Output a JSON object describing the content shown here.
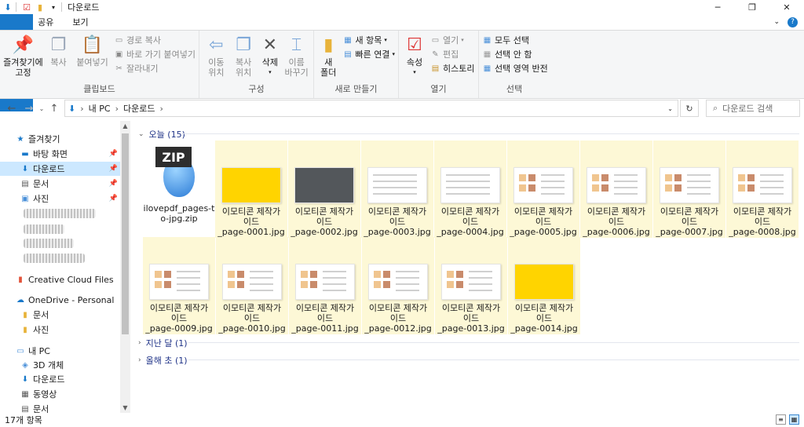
{
  "window": {
    "title": "다운로드",
    "minimize": "─",
    "maximize": "❐",
    "close": "✕"
  },
  "tabs": [
    "파일",
    "홈",
    "공유",
    "보기"
  ],
  "ribbon": {
    "clipboard": {
      "pin_label_1": "즐겨찾기에",
      "pin_label_2": "고정",
      "copy": "복사",
      "paste": "붙여넣기",
      "copy_path": "경로 복사",
      "paste_shortcut": "바로 가기 붙여넣기",
      "cut": "잘라내기",
      "group": "클립보드"
    },
    "organize": {
      "move_1": "이동",
      "move_2": "위치",
      "copy_1": "복사",
      "copy_2": "위치",
      "delete": "삭제",
      "rename_1": "이름",
      "rename_2": "바꾸기",
      "group": "구성"
    },
    "new": {
      "new_folder_1": "새",
      "new_folder_2": "폴더",
      "new_item": "새 항목",
      "easy_access": "빠른 연결",
      "group": "새로 만들기"
    },
    "open": {
      "properties": "속성",
      "open": "열기",
      "edit": "편집",
      "history": "히스토리",
      "group": "열기"
    },
    "select": {
      "select_all": "모두 선택",
      "select_none": "선택 안 함",
      "invert": "선택 영역 반전",
      "group": "선택"
    }
  },
  "address": {
    "crumbs": [
      "내 PC",
      "다운로드"
    ],
    "search_placeholder": "다운로드 검색"
  },
  "sidebar": {
    "quick_access": "즐겨찾기",
    "desktop": "바탕 화면",
    "downloads": "다운로드",
    "documents": "문서",
    "pictures": "사진",
    "creative_cloud": "Creative Cloud Files",
    "onedrive": "OneDrive - Personal",
    "od_documents": "문서",
    "od_pictures": "사진",
    "this_pc": "내 PC",
    "objects3d": "3D 개체",
    "pc_downloads": "다운로드",
    "videos": "동영상",
    "pc_documents": "문서"
  },
  "groups": {
    "today": "오늘 (15)",
    "last_month": "지난 달 (1)",
    "earlier_year": "올해 초 (1)"
  },
  "files": {
    "zip_line1": "ilovepdf_pages-t",
    "zip_line2": "o-jpg.zip",
    "zip_badge": "ZIP",
    "name_line1": "이모티콘 제작가",
    "name_line2": "이드",
    "pages": [
      "_page-0001.jpg",
      "_page-0002.jpg",
      "_page-0003.jpg",
      "_page-0004.jpg",
      "_page-0005.jpg",
      "_page-0006.jpg",
      "_page-0007.jpg",
      "_page-0008.jpg",
      "_page-0009.jpg",
      "_page-0010.jpg",
      "_page-0011.jpg",
      "_page-0012.jpg",
      "_page-0013.jpg",
      "_page-0014.jpg"
    ]
  },
  "status": {
    "count": "17개 항목"
  },
  "colors": {
    "accent": "#1979ca",
    "selection": "#cce8ff",
    "file_selected": "#fdf8d6",
    "group_header": "#1e3287",
    "yellow_page": "#ffd400"
  }
}
